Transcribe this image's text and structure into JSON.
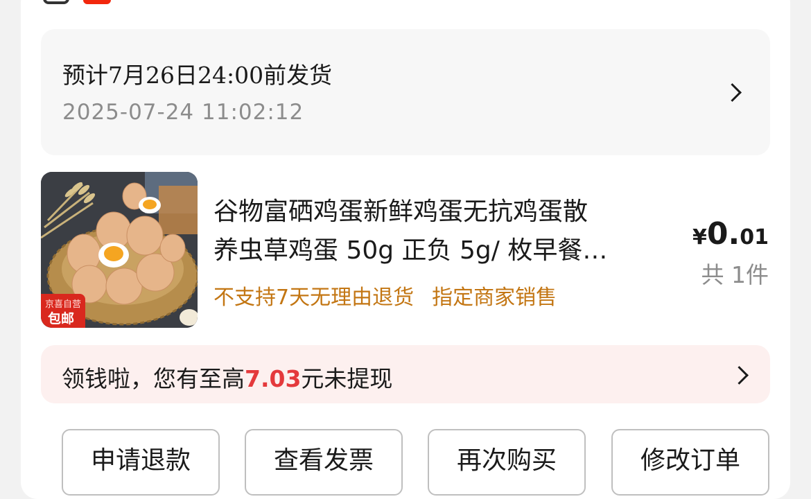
{
  "shipping": {
    "estimate": "预计7月26日24:00前发货",
    "timestamp": "2025-07-24 11:02:12",
    "chevron_icon": "chevron-right-icon"
  },
  "product": {
    "image_icon": "egg-basket-product-image",
    "badge_top": "京喜自营",
    "badge_main": "包邮",
    "title_line1": "谷物富硒鸡蛋新鲜鸡蛋无抗鸡蛋散",
    "title_line2": "养虫草鸡蛋 50g 正负 5g/ 枚早餐…",
    "tag_return": "不支持7天无理由退货",
    "tag_seller": "指定商家销售",
    "price_currency": "¥",
    "price_integer": "0.",
    "price_decimal": "01",
    "quantity": "共 1件"
  },
  "cashback": {
    "prefix": "领钱啦，您有至高",
    "amount": "7.03",
    "suffix": "元未提现",
    "chevron_icon": "chevron-right-icon"
  },
  "actions": {
    "refund": "申请退款",
    "invoice": "查看发票",
    "rebuy": "再次购买",
    "modify": "修改订单"
  },
  "colors": {
    "accent_red": "#e4393c",
    "tag_orange": "#c37613",
    "muted_gray": "#8c8c8c",
    "page_bg": "#f2f2f2"
  }
}
